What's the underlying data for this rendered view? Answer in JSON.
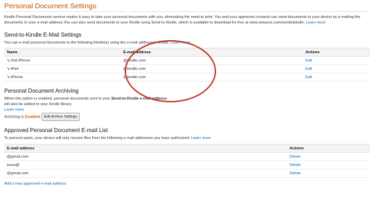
{
  "page": {
    "title": "Personal Document Settings",
    "intro_text": "Kindle Personal Documents service makes it easy to take your personal documents with you, eliminating the need to print. You and your approved contacts can send documents to your device by e-mailing the documents to your e-mail address.You can also send documents to your Kindle using Send to Kindle, which is available to download for free at www.amazon.com/sendtokindle.",
    "intro_link": "Learn more"
  },
  "send_to_kindle": {
    "title": "Send-to-Kindle E-Mail Settings",
    "description": "You can e-mail personal documents to the following Kindle(s) using the e-mail addresses shown.",
    "learn_more": "Learn more",
    "columns": [
      "Name",
      "E-mail address",
      "Actions"
    ],
    "rows": [
      {
        "name": "'s 2nd iPhone",
        "email": "@kindle.com",
        "action": "Edit"
      },
      {
        "name": "'s iPad",
        "email": "@kindle.com",
        "action": "Edit"
      },
      {
        "name": "'s iPhone",
        "email": "@kindle.com",
        "action": "Edit"
      }
    ]
  },
  "archiving": {
    "title": "Personal Document Archiving",
    "desc_prefix": "When this option is enabled, personal documents sent to your",
    "desc_bold": "Send-to-Kindle e-mail address",
    "desc_line2": "will also be added to your Kindle library.",
    "learn_more": "Learn more",
    "status_label": "Archiving is",
    "status_value": "Enabled",
    "button_label": "Edit Archive Settings"
  },
  "approved_list": {
    "title": "Approved Personal Document E-mail List",
    "description": "To prevent spam, your device will only receive files from the following e-mail addresses you have authorized.",
    "learn_more": "Learn more",
    "columns": [
      "E-mail address",
      "Actions"
    ],
    "rows": [
      {
        "email": "@gmail.com",
        "action": "Delete"
      },
      {
        "email": "laura@",
        "action": "Delete"
      },
      {
        "email": "@gmail.com",
        "action": "Delete"
      }
    ],
    "add_link": "Add a new approved e-mail address"
  },
  "colors": {
    "title": "#c45500",
    "link": "#0066c0",
    "annotation": "#c0392b"
  }
}
